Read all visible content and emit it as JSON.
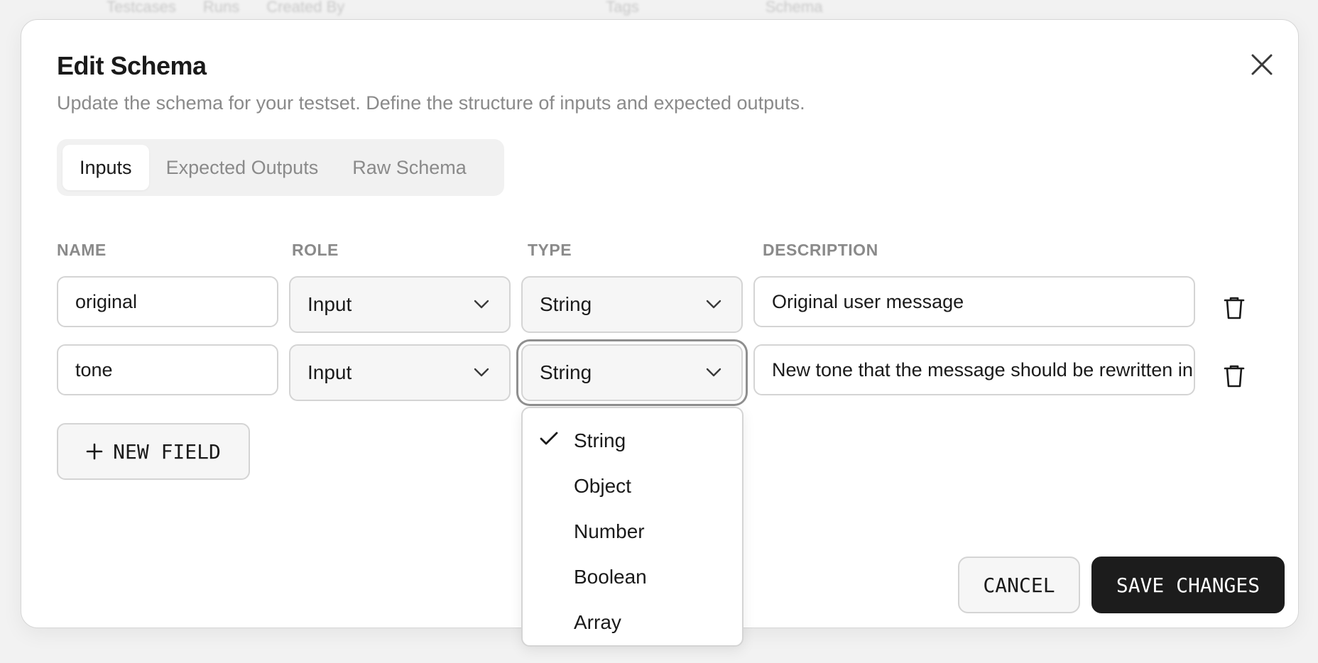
{
  "background_header": [
    "Testcases",
    "Runs",
    "Created By",
    "Tags",
    "Schema"
  ],
  "modal": {
    "title": "Edit Schema",
    "subtitle": "Update the schema for your testset. Define the structure of inputs and expected outputs.",
    "close_icon": "close-icon"
  },
  "tabs": [
    {
      "label": "Inputs",
      "active": true
    },
    {
      "label": "Expected Outputs",
      "active": false
    },
    {
      "label": "Raw Schema",
      "active": false
    }
  ],
  "columns": {
    "name": "NAME",
    "role": "ROLE",
    "type": "TYPE",
    "description": "DESCRIPTION"
  },
  "rows": [
    {
      "name": "original",
      "role": "Input",
      "type": "String",
      "description": "Original user message"
    },
    {
      "name": "tone",
      "role": "Input",
      "type": "String",
      "description": "New tone that the message should be rewritten in"
    }
  ],
  "new_field": {
    "icon": "plus-icon",
    "label": "NEW FIELD"
  },
  "type_dropdown": {
    "selected": "String",
    "options": [
      "String",
      "Object",
      "Number",
      "Boolean",
      "Array"
    ]
  },
  "actions": {
    "cancel": "CANCEL",
    "save": "SAVE CHANGES"
  },
  "colors": {
    "primary_button": "#1c1c1c",
    "muted_text": "#8a8a8a",
    "border": "#d4d4d4"
  }
}
